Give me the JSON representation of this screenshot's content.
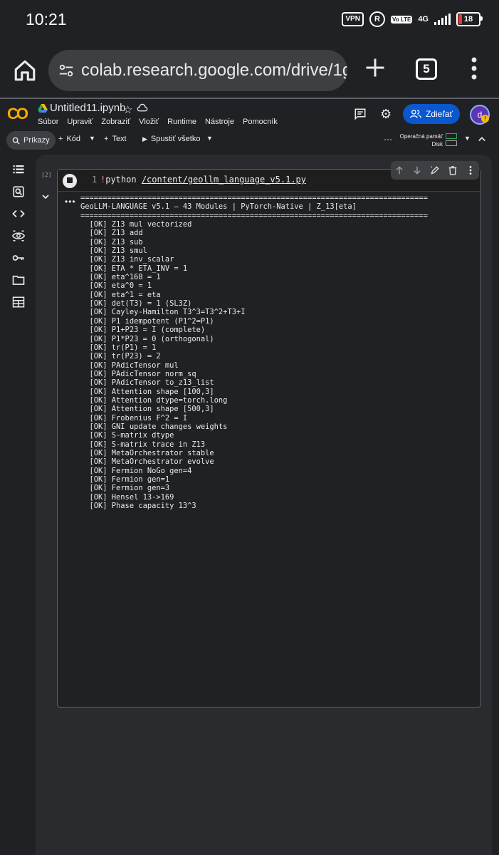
{
  "status_bar": {
    "time": "10:21",
    "vpn": "VPN",
    "r_icon": "R",
    "lte": "Vo LTE",
    "network": "4G",
    "battery": "18"
  },
  "browser": {
    "url": "colab.research.google.com/drive/1g",
    "tab_count": "5"
  },
  "colab": {
    "notebook_title": "Untitled11.ipynb",
    "menu": [
      "Súbor",
      "Upraviť",
      "Zobraziť",
      "Vložiť",
      "Runtime",
      "Nástroje",
      "Pomocník"
    ],
    "share_label": "Zdieľať",
    "avatar_letter": "d",
    "avatar_badge": "!"
  },
  "toolbar": {
    "commands_label": "Príkazy",
    "add_code_label": "Kód",
    "add_text_label": "Text",
    "run_all_label": "Spustiť všetko",
    "ram_label": "Operačná pamäť",
    "disk_label": "Disk"
  },
  "cell": {
    "execution_count": "[2]",
    "line_number": "1",
    "code_bang": "!",
    "code_cmd": "python ",
    "code_path": "/content/geollm_language_v5.1.py",
    "output": "==============================================================================\nGeoLLM-LANGUAGE v5.1 — 43 Modules | PyTorch-Native | Z_13[eta]\n==============================================================================\n  [OK] Z13 mul vectorized\n  [OK] Z13 add\n  [OK] Z13 sub\n  [OK] Z13 smul\n  [OK] Z13 inv_scalar\n  [OK] ETA * ETA_INV = 1\n  [OK] eta^168 = 1\n  [OK] eta^0 = 1\n  [OK] eta^1 = eta\n  [OK] det(T3) = 1 (SL3Z)\n  [OK] Cayley-Hamilton T3^3=T3^2+T3+I\n  [OK] P1 idempotent (P1^2=P1)\n  [OK] P1+P23 = I (complete)\n  [OK] P1*P23 = 0 (orthogonal)\n  [OK] tr(P1) = 1\n  [OK] tr(P23) = 2\n  [OK] PAdicTensor mul\n  [OK] PAdicTensor norm_sq\n  [OK] PAdicTensor to_z13_list\n  [OK] Attention shape [100,3]\n  [OK] Attention dtype=torch.long\n  [OK] Attention shape [500,3]\n  [OK] Frobenius F^2 = I\n  [OK] GNI update changes weights\n  [OK] S-matrix dtype\n  [OK] S-matrix trace in Z13\n  [OK] MetaOrchestrator stable\n  [OK] MetaOrchestrator evolve\n  [OK] Fermion NoGo gen=4\n  [OK] Fermion gen=1\n  [OK] Fermion gen=3\n  [OK] Hensel 13->169\n  [OK] Phase capacity 13^3"
  },
  "icons": {
    "home": "home-icon",
    "site_settings": "tune-icon",
    "new_tab": "plus-icon",
    "menu": "more-vert-icon"
  },
  "colors": {
    "background": "#202124",
    "share_button": "#0b57d0",
    "logo": "#f9ab00",
    "status_ok": "#34a853"
  }
}
